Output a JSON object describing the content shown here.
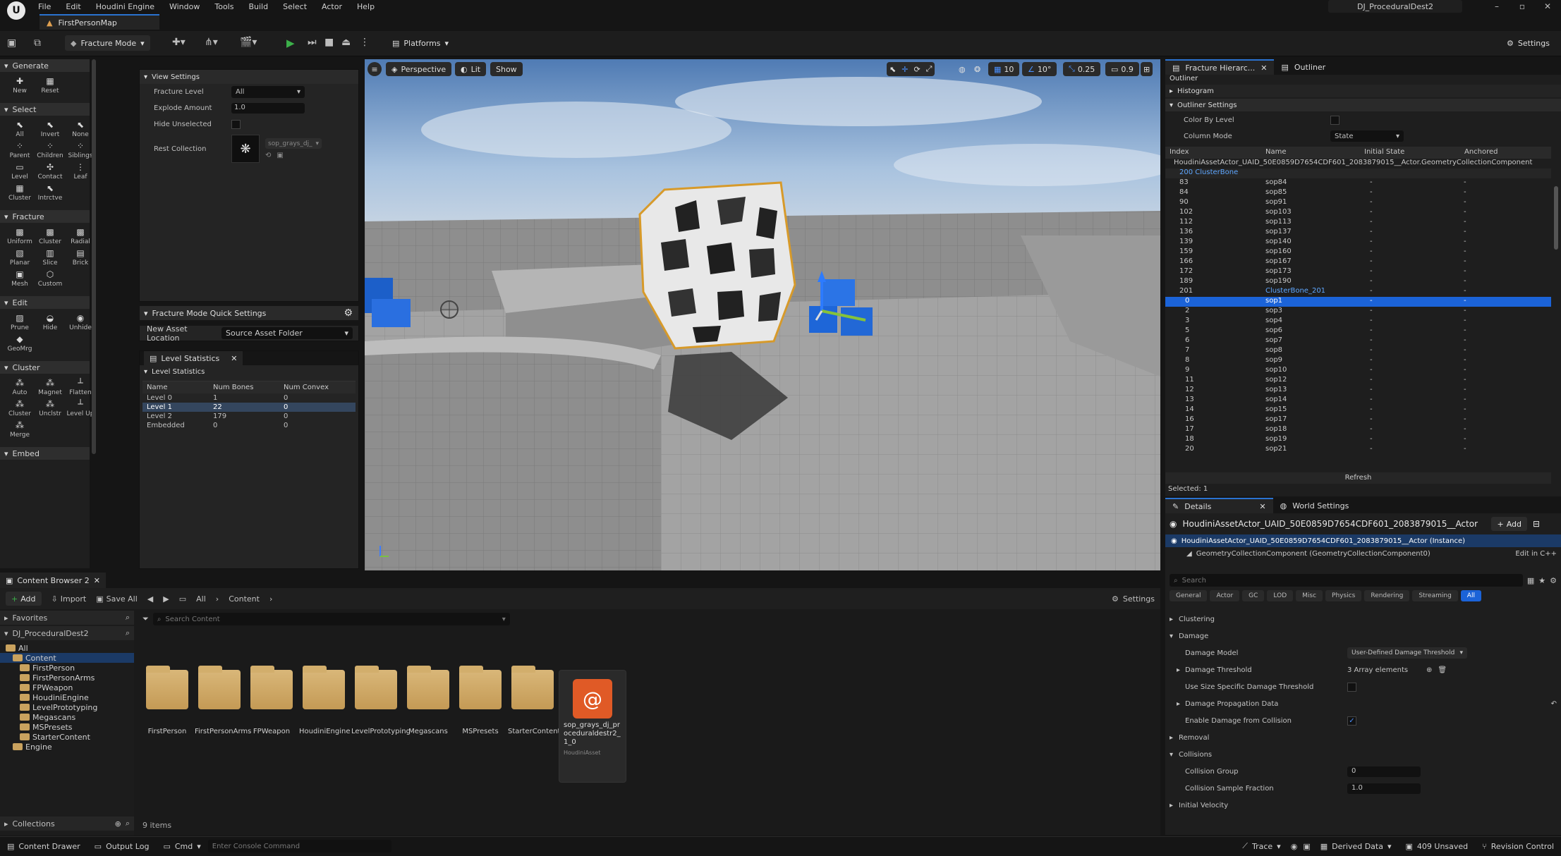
{
  "menubar": {
    "items": [
      "File",
      "Edit",
      "Houdini Engine",
      "Window",
      "Tools",
      "Build",
      "Select",
      "Actor",
      "Help"
    ],
    "project_name": "DJ_ProceduralDest2",
    "map_tab": "FirstPersonMap"
  },
  "toolbar": {
    "mode": "Fracture Mode",
    "platforms": "Platforms",
    "settings": "Settings"
  },
  "tools": {
    "generate": {
      "title": "Generate",
      "items": [
        "New",
        "Reset"
      ]
    },
    "select": {
      "title": "Select",
      "items": [
        "All",
        "Invert",
        "None",
        "Parent",
        "Children",
        "Siblings",
        "Level",
        "Contact",
        "Leaf",
        "Cluster",
        "Intrctve"
      ]
    },
    "fracture": {
      "title": "Fracture",
      "items": [
        "Uniform",
        "Cluster",
        "Radial",
        "Planar",
        "Slice",
        "Brick",
        "Mesh",
        "Custom"
      ]
    },
    "edit": {
      "title": "Edit",
      "items": [
        "Prune",
        "Hide",
        "Unhide",
        "GeoMrg"
      ]
    },
    "cluster": {
      "title": "Cluster",
      "items": [
        "Auto",
        "Magnet",
        "Flatten",
        "Cluster",
        "Unclstr",
        "Level Up",
        "Merge"
      ]
    },
    "embed": {
      "title": "Embed"
    }
  },
  "view_settings": {
    "title": "View Settings",
    "fracture_level_label": "Fracture Level",
    "fracture_level_value": "All",
    "explode_label": "Explode Amount",
    "explode_value": "1.0",
    "hide_unselected_label": "Hide Unselected",
    "rest_collection_label": "Rest Collection",
    "rest_collection_value": "sop_grays_dj_",
    "quick_settings_title": "Fracture Mode Quick Settings",
    "new_asset_label": "New Asset Location",
    "new_asset_value": "Source Asset Folder"
  },
  "level_stats": {
    "tab": "Level Statistics",
    "section": "Level Statistics",
    "headers": [
      "Name",
      "Num Bones",
      "Num Convex"
    ],
    "rows": [
      [
        "Level 0",
        "1",
        "0"
      ],
      [
        "Level 1",
        "22",
        "0"
      ],
      [
        "Level 2",
        "179",
        "0"
      ],
      [
        "Embedded",
        "0",
        "0"
      ]
    ]
  },
  "viewport": {
    "perspective": "Perspective",
    "lit": "Lit",
    "show": "Show",
    "grid": "10",
    "angle": "10°",
    "scale": "0.25",
    "cam": "0.9"
  },
  "fracture_hierarchy": {
    "tab": "Fracture Hierarc...",
    "tab2": "Outliner",
    "outliner": "Outliner",
    "histogram": "Histogram",
    "outliner_settings": "Outliner Settings",
    "color_by_level": "Color By Level",
    "column_mode": "Column Mode",
    "column_mode_value": "State",
    "headers": [
      "Index",
      "Name",
      "Initial State",
      "Anchored"
    ],
    "root": "HoudiniAssetActor_UAID_50E0859D7654CDF601_2083879015__Actor.GeometryCollectionComponent",
    "cluster_root": "200 ClusterBone",
    "rows": [
      [
        "83",
        "sop84",
        "-",
        "-"
      ],
      [
        "84",
        "sop85",
        "-",
        "-"
      ],
      [
        "90",
        "sop91",
        "-",
        "-"
      ],
      [
        "102",
        "sop103",
        "-",
        "-"
      ],
      [
        "112",
        "sop113",
        "-",
        "-"
      ],
      [
        "136",
        "sop137",
        "-",
        "-"
      ],
      [
        "139",
        "sop140",
        "-",
        "-"
      ],
      [
        "159",
        "sop160",
        "-",
        "-"
      ],
      [
        "166",
        "sop167",
        "-",
        "-"
      ],
      [
        "172",
        "sop173",
        "-",
        "-"
      ],
      [
        "189",
        "sop190",
        "-",
        "-"
      ],
      [
        "201",
        "ClusterBone_201",
        "-",
        "-"
      ],
      [
        "0",
        "sop1",
        "-",
        "-"
      ],
      [
        "2",
        "sop3",
        "-",
        "-"
      ],
      [
        "3",
        "sop4",
        "-",
        "-"
      ],
      [
        "5",
        "sop6",
        "-",
        "-"
      ],
      [
        "6",
        "sop7",
        "-",
        "-"
      ],
      [
        "7",
        "sop8",
        "-",
        "-"
      ],
      [
        "8",
        "sop9",
        "-",
        "-"
      ],
      [
        "9",
        "sop10",
        "-",
        "-"
      ],
      [
        "11",
        "sop12",
        "-",
        "-"
      ],
      [
        "12",
        "sop13",
        "-",
        "-"
      ],
      [
        "13",
        "sop14",
        "-",
        "-"
      ],
      [
        "14",
        "sop15",
        "-",
        "-"
      ],
      [
        "16",
        "sop17",
        "-",
        "-"
      ],
      [
        "17",
        "sop18",
        "-",
        "-"
      ],
      [
        "18",
        "sop19",
        "-",
        "-"
      ],
      [
        "20",
        "sop21",
        "-",
        "-"
      ]
    ],
    "refresh": "Refresh",
    "selected": "Selected: 1"
  },
  "details": {
    "tab": "Details",
    "tab2": "World Settings",
    "actor_name": "HoudiniAssetActor_UAID_50E0859D7654CDF601_2083879015__Actor",
    "add": "Add",
    "instance": "HoudiniAssetActor_UAID_50E0859D7654CDF601_2083879015__Actor (Instance)",
    "component": "GeometryCollectionComponent (GeometryCollectionComponent0)",
    "edit_cpp": "Edit in C++",
    "search_placeholder": "Search",
    "filters": [
      "General",
      "Actor",
      "GC",
      "LOD",
      "Misc",
      "Physics",
      "Rendering",
      "Streaming",
      "All"
    ],
    "sections": {
      "clustering": "Clustering",
      "damage": "Damage",
      "damage_model_label": "Damage Model",
      "damage_model_value": "User-Defined Damage Threshold",
      "damage_threshold_label": "Damage Threshold",
      "damage_threshold_value": "3 Array elements",
      "use_size_label": "Use Size Specific Damage Threshold",
      "propagation_label": "Damage Propagation Data",
      "enable_collision_label": "Enable Damage from Collision",
      "removal": "Removal",
      "collisions": "Collisions",
      "collision_group_label": "Collision Group",
      "collision_group_value": "0",
      "collision_fraction_label": "Collision Sample Fraction",
      "collision_fraction_value": "1.0",
      "initial_velocity": "Initial Velocity"
    }
  },
  "content_browser": {
    "tab": "Content Browser 2",
    "add": "Add",
    "import": "Import",
    "save_all": "Save All",
    "path_all": "All",
    "path_content": "Content",
    "settings": "Settings",
    "favorites": "Favorites",
    "project": "DJ_ProceduralDest2",
    "search_placeholder": "Search Content",
    "tree": [
      "All",
      "Content",
      "FirstPerson",
      "FirstPersonArms",
      "FPWeapon",
      "HoudiniEngine",
      "LevelPrototyping",
      "Megascans",
      "MSPresets",
      "StarterContent",
      "Engine"
    ],
    "folders": [
      "FirstPerson",
      "FirstPersonArms",
      "FPWeapon",
      "HoudiniEngine",
      "LevelPrototyping",
      "Megascans",
      "MSPresets",
      "StarterContent"
    ],
    "asset_name": "sop_grays_dj_proceduraldestr2_1_0",
    "asset_type": "HoudiniAsset",
    "collections": "Collections",
    "item_count": "9 items"
  },
  "statusbar": {
    "content_drawer": "Content Drawer",
    "output_log": "Output Log",
    "cmd": "Cmd",
    "console_placeholder": "Enter Console Command",
    "trace": "Trace",
    "derived_data": "Derived Data",
    "unsaved": "409 Unsaved",
    "revision": "Revision Control"
  },
  "colors": {
    "accent": "#1b63d8",
    "folder": "#c9a25e",
    "selection": "#1b63d8"
  }
}
